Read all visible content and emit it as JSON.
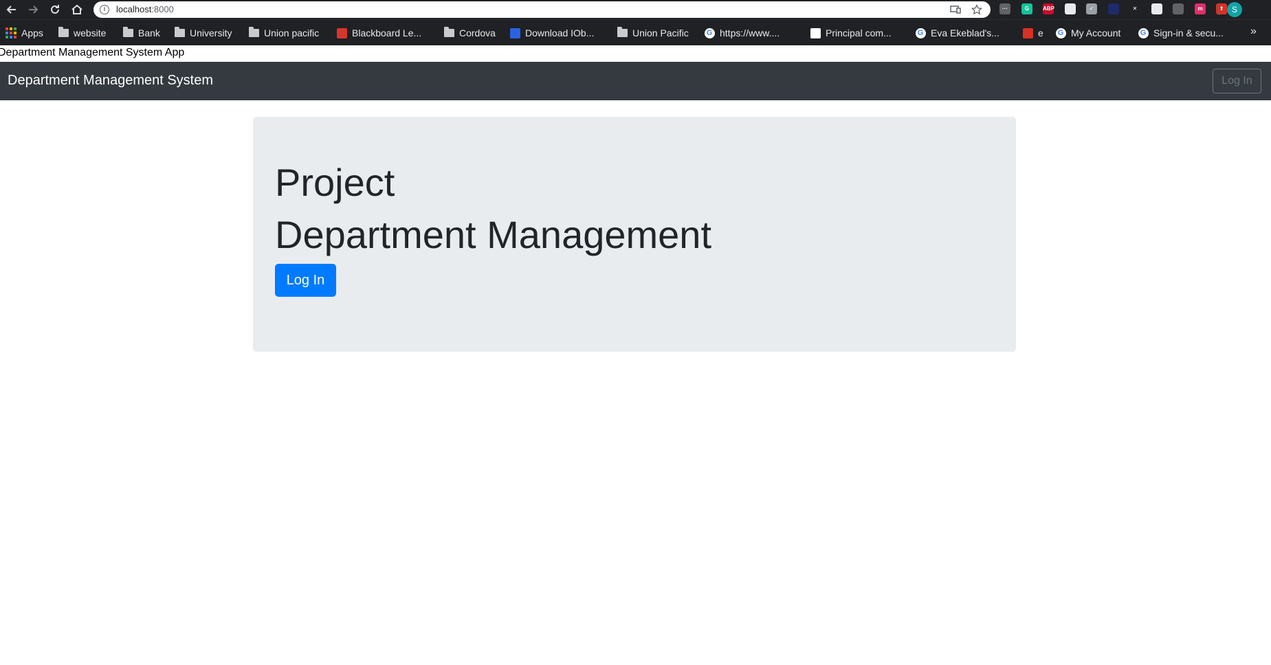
{
  "browser": {
    "url_host": "localhost",
    "url_port": ":8000",
    "icons": {
      "back": "back-arrow-icon",
      "forward": "forward-arrow-icon",
      "reload": "reload-icon",
      "home": "home-icon",
      "site_info": "info-icon",
      "install": "install-app-icon",
      "star": "star-icon"
    },
    "extensions": [
      {
        "name": "more-extension-icon",
        "label": "···",
        "color": "#5f6368"
      },
      {
        "name": "grammarly-extension-icon",
        "label": "G",
        "color": "#15c39a"
      },
      {
        "name": "adblock-plus-extension-icon",
        "label": "ABP",
        "color": "#c70d2c"
      },
      {
        "name": "document-extension-icon",
        "label": "",
        "color": "#e8eaed"
      },
      {
        "name": "check-extension-icon",
        "label": "✓",
        "color": "#9aa0a6"
      },
      {
        "name": "dark-extension-icon",
        "label": "",
        "color": "#1f2a6b"
      },
      {
        "name": "close-extension-icon",
        "label": "✕",
        "color": "#202124"
      },
      {
        "name": "printer-extension-icon",
        "label": "",
        "color": "#e8eaed"
      },
      {
        "name": "grid-extension-icon",
        "label": "",
        "color": "#5f6368"
      },
      {
        "name": "m-extension-icon",
        "label": "m",
        "color": "#e02f6b"
      },
      {
        "name": "upload-extension-icon",
        "label": "⬆",
        "color": "#d93025"
      }
    ],
    "profile_initial": "S",
    "bookmarks": [
      {
        "label": "Apps",
        "icon": "apps-grid-icon",
        "type": "apps"
      },
      {
        "label": "website",
        "icon": "folder-icon",
        "type": "folder"
      },
      {
        "label": "Bank",
        "icon": "folder-icon",
        "type": "folder"
      },
      {
        "label": "University",
        "icon": "folder-icon",
        "type": "folder"
      },
      {
        "label": "Union pacific",
        "icon": "folder-icon",
        "type": "folder"
      },
      {
        "label": "Blackboard Le...",
        "icon": "blackboard-icon",
        "type": "site",
        "color": "#d6372c"
      },
      {
        "label": "Cordova",
        "icon": "folder-icon",
        "type": "folder"
      },
      {
        "label": "Download IOb...",
        "icon": "iobit-icon",
        "type": "site",
        "color": "#2a62e3"
      },
      {
        "label": "Union Pacific",
        "icon": "folder-icon",
        "type": "folder"
      },
      {
        "label": "https://www....",
        "icon": "google-icon",
        "type": "google"
      },
      {
        "label": "Principal com...",
        "icon": "w-icon",
        "type": "site",
        "color": "#ffffff"
      },
      {
        "label": "Eva Ekeblad's...",
        "icon": "google-icon",
        "type": "google"
      },
      {
        "label": "e",
        "icon": "red-site-icon",
        "type": "site",
        "color": "#d93025"
      },
      {
        "label": "My Account",
        "icon": "google-icon",
        "type": "google"
      },
      {
        "label": "Sign-in & secu...",
        "icon": "google-icon",
        "type": "google"
      }
    ],
    "more_bookmarks": "»"
  },
  "page": {
    "document_title": "Department Management System App",
    "navbar": {
      "brand": "Department Management System",
      "login_label": "Log In"
    },
    "jumbotron": {
      "line1": "Project",
      "line2": "Department Management",
      "login_label": "Log In"
    }
  }
}
